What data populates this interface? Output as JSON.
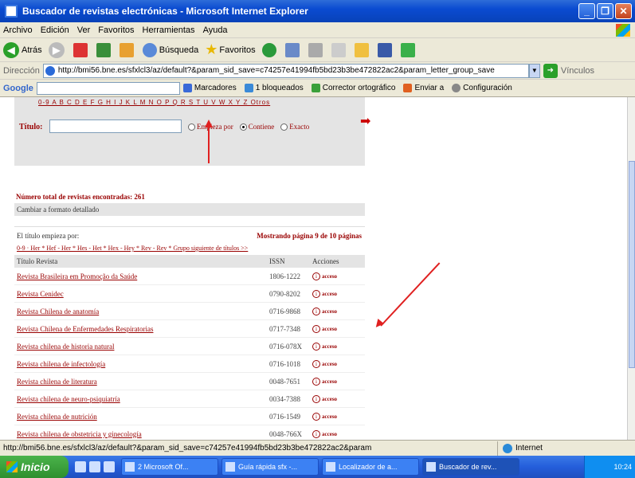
{
  "window": {
    "title": "Buscador de revistas electrónicas - Microsoft Internet Explorer"
  },
  "menu": [
    "Archivo",
    "Edición",
    "Ver",
    "Favoritos",
    "Herramientas",
    "Ayuda"
  ],
  "toolbar": {
    "back": "Atrás",
    "search": "Búsqueda",
    "favorites": "Favoritos",
    "links": "Vínculos"
  },
  "address": {
    "label": "Dirección",
    "url": "http://bmi56.bne.es/sfxlcl3/az/default?&param_sid_save=c74257e41994fb5bd23b3be472822ac2&param_letter_group_save"
  },
  "googlebar": {
    "logo": "Google",
    "bookmarks": "Marcadores",
    "blocked": "1 bloqueados",
    "spell": "Corrector ortográfico",
    "send": "Enviar a",
    "config": "Configuración"
  },
  "content": {
    "alphabet": "0-9 A B C D E F G H I J K L M N O P Q R S T U V W X Y Z Otros",
    "titulo_label": "Título:",
    "titulo_value": "",
    "radios": [
      "Empieza por",
      "Contiene",
      "Exacto"
    ],
    "total": "Número total de revistas encontradas: 261",
    "detail": "Cambiar a formato detallado",
    "orden": "El título empieza por:",
    "paging": "Mostrando página 9 de 10 páginas",
    "sortlinks": "0-9 · Her * Hef - Her * Hes - Het * Hex - Hey * Rev - Rev * Grupo siguiente de títulos >>",
    "col_title": "Título Revista",
    "col_issn": "ISSN",
    "col_actions": "Acciones",
    "acceso": "acceso",
    "rows": [
      {
        "title": "Revista Brasileira em Promoção da Saúde",
        "issn": "1806-1222"
      },
      {
        "title": "Revista Cenidec",
        "issn": "0790-8202"
      },
      {
        "title": "Revista Chilena de anatomía",
        "issn": "0716-9868"
      },
      {
        "title": "Revista Chilena de Enfermedades Respiratorias",
        "issn": "0717-7348"
      },
      {
        "title": "Revista chilena de historia natural",
        "issn": "0716-078X"
      },
      {
        "title": "Revista chilena de infectología",
        "issn": "0716-1018"
      },
      {
        "title": "Revista chilena de literatura",
        "issn": "0048-7651"
      },
      {
        "title": "Revista chilena de neuro-psiquiatría",
        "issn": "0034-7388"
      },
      {
        "title": "Revista chilena de nutrición",
        "issn": "0716-1549"
      },
      {
        "title": "Revista chilena de obstetricia y ginecología",
        "issn": "0048-766X"
      }
    ]
  },
  "status": {
    "text": "http://bmi56.bne.es/sfxlcl3/az/default?&param_sid_save=c74257e41994fb5bd23b3be472822ac2&param",
    "zone": "Internet"
  },
  "taskbar": {
    "start": "Inicio",
    "tasks": [
      "2 Microsoft Of...",
      "Guía rápida sfx -...",
      "Localizador de a...",
      "Buscador de rev..."
    ],
    "clock": "10:24"
  }
}
